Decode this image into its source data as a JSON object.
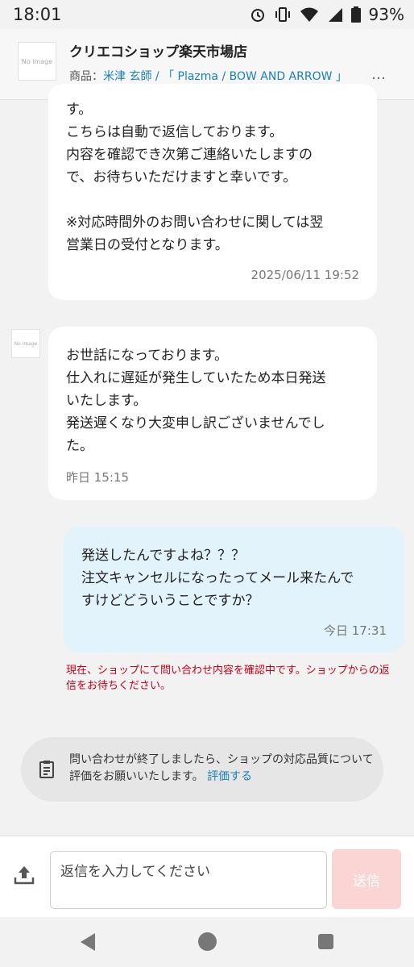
{
  "status_bar": {
    "time": "18:01",
    "battery": "93%"
  },
  "header": {
    "shop_name": "クリエコショップ楽天市場店",
    "logo_text": "No image",
    "product_prefix": "商品：",
    "product_link": "米津 玄師 / 「 Plazma / BOW AND ARROW 」",
    "more": "…"
  },
  "messages": [
    {
      "sender": "shop",
      "text": "す。\nこちらは自動で返信しております。\n内容を確認でき次第ご連絡いたしますの\nで、お待ちいただけますと幸いです。\n\n※対応時間外のお問い合わせに関しては翌\n営業日の受付となります。",
      "time": "2025/06/11 19:52"
    },
    {
      "sender": "shop",
      "avatar_text": "No image",
      "text": "お世話になっております。\n仕入れに遅延が発生していたため本日発送\nいたします。\n発送遅くなり大変申し訳ございませんでし\nた。",
      "time": "昨日 15:15"
    },
    {
      "sender": "user",
      "text": "発送したんですよね？？？\n注文キャンセルになったってメール来たんで\nすけどどういうことですか？",
      "time": "今日 17:31"
    }
  ],
  "notice": "現在、ショップにて問い合わせ内容を確認中です。ショップからの返信をお待ちください。",
  "review": {
    "text": "問い合わせが終了しましたら、ショップの対応品質について評価をお願いいたします。",
    "link": "評価する"
  },
  "composer": {
    "placeholder": "返信を入力してください",
    "send_label": "送信"
  },
  "colors": {
    "link": "#1a7fb8",
    "notice": "#c0001a",
    "user_bubble": "#e3f3fc",
    "send_disabled": "#fbd4d4"
  }
}
